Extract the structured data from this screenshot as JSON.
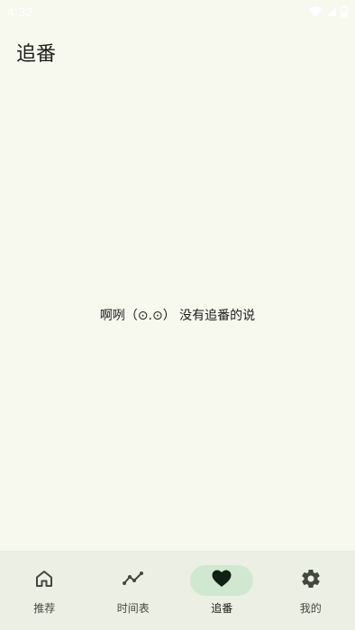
{
  "status_bar": {
    "time": "4:32"
  },
  "header": {
    "title": "追番"
  },
  "main": {
    "empty_message": "啊咧（⊙.⊙） 没有追番的说"
  },
  "bottom_nav": {
    "items": [
      {
        "label": "推荐",
        "icon": "home-icon",
        "active": false
      },
      {
        "label": "时间表",
        "icon": "timeline-icon",
        "active": false
      },
      {
        "label": "追番",
        "icon": "heart-icon",
        "active": true
      },
      {
        "label": "我的",
        "icon": "gear-icon",
        "active": false
      }
    ]
  },
  "colors": {
    "background": "#f7f9ef",
    "nav_background": "#ecefe4",
    "active_indicator": "#d1e8d0",
    "icon": "#43483f",
    "active_icon": "#102014"
  }
}
